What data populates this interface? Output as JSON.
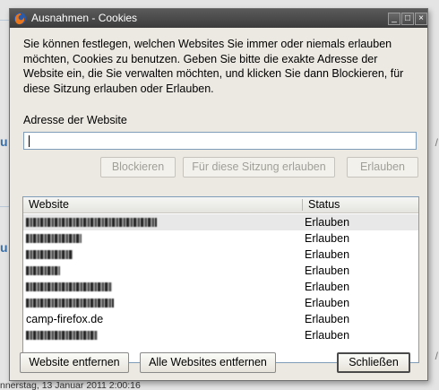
{
  "window": {
    "title": "Ausnahmen - Cookies",
    "controls": {
      "minimize": "_",
      "maximize": "□",
      "close": "×"
    }
  },
  "intro_text": "Sie können festlegen, welchen Websites Sie immer oder niemals erlauben möchten, Cookies zu benutzen. Geben Sie bitte die exakte Adresse der Website ein, die Sie verwalten möchten, und klicken Sie dann Blockieren, für diese Sitzung erlauben oder Erlauben.",
  "address": {
    "label": "Adresse der Website",
    "value": ""
  },
  "actions": {
    "block": "Blockieren",
    "allow_session": "Für diese Sitzung erlauben",
    "allow": "Erlauben"
  },
  "table": {
    "columns": {
      "website": "Website",
      "status": "Status"
    },
    "rows": [
      {
        "site": "",
        "redacted": true,
        "status": "Erlauben"
      },
      {
        "site": "",
        "redacted": true,
        "status": "Erlauben"
      },
      {
        "site": "",
        "redacted": true,
        "status": "Erlauben"
      },
      {
        "site": "",
        "redacted": true,
        "status": "Erlauben"
      },
      {
        "site": "",
        "redacted": true,
        "status": "Erlauben"
      },
      {
        "site": "",
        "redacted": true,
        "status": "Erlauben"
      },
      {
        "site": "camp-firefox.de",
        "redacted": false,
        "status": "Erlauben"
      },
      {
        "site": "",
        "redacted": true,
        "status": "Erlauben"
      }
    ]
  },
  "footer": {
    "remove": "Website entfernen",
    "remove_all": "Alle Websites entfernen",
    "close": "Schließen"
  },
  "background": {
    "footer_text": "nnerstag, 13 Januar 2011 2:00:16"
  },
  "colors": {
    "titlebar": "#3c3c3c",
    "dialog_bg": "#ece9e2",
    "input_border": "#7f9db9"
  }
}
